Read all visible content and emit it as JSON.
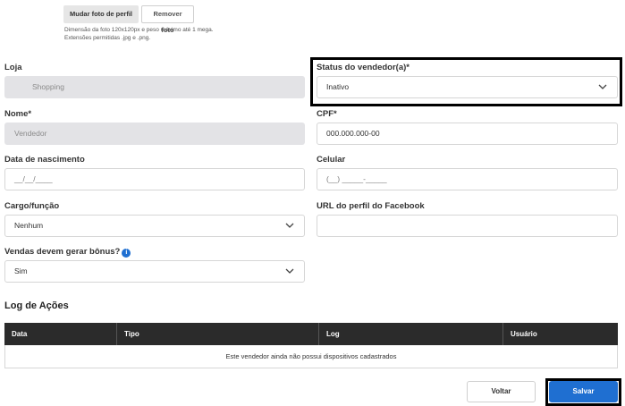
{
  "photo": {
    "change_label": "Mudar foto de perfil",
    "remove_label": "Remover foto",
    "hint_line1": "Dimensão da foto 120x120px e peso máximo até 1 mega.",
    "hint_line2": "Extensões permitidas .jpg e .png."
  },
  "form": {
    "loja": {
      "label": "Loja",
      "value": "Shopping"
    },
    "status": {
      "label": "Status do vendedor(a)*",
      "value": "Inativo"
    },
    "nome": {
      "label": "Nome*",
      "value": "Vendedor"
    },
    "cpf": {
      "label": "CPF*",
      "value": "000.000.000-00"
    },
    "nascimento": {
      "label": "Data de nascimento",
      "placeholder": "__/__/____"
    },
    "celular": {
      "label": "Celular",
      "placeholder": "(__) _____-_____"
    },
    "cargo": {
      "label": "Cargo/função",
      "value": "Nenhum"
    },
    "facebook": {
      "label": "URL do perfil do Facebook",
      "value": ""
    },
    "bonus": {
      "label": "Vendas devem gerar bônus?",
      "value": "Sim",
      "info_icon": "info-icon"
    }
  },
  "log": {
    "title": "Log de Ações",
    "columns": [
      "Data",
      "Tipo",
      "Log",
      "Usuário"
    ],
    "empty_message": "Este vendedor ainda não possui dispositivos cadastrados"
  },
  "actions": {
    "back_label": "Voltar",
    "save_label": "Salvar"
  },
  "colors": {
    "accent": "#1f6fd1",
    "table_header": "#2b2b2b",
    "disabled_bg": "#e3e3e6"
  }
}
